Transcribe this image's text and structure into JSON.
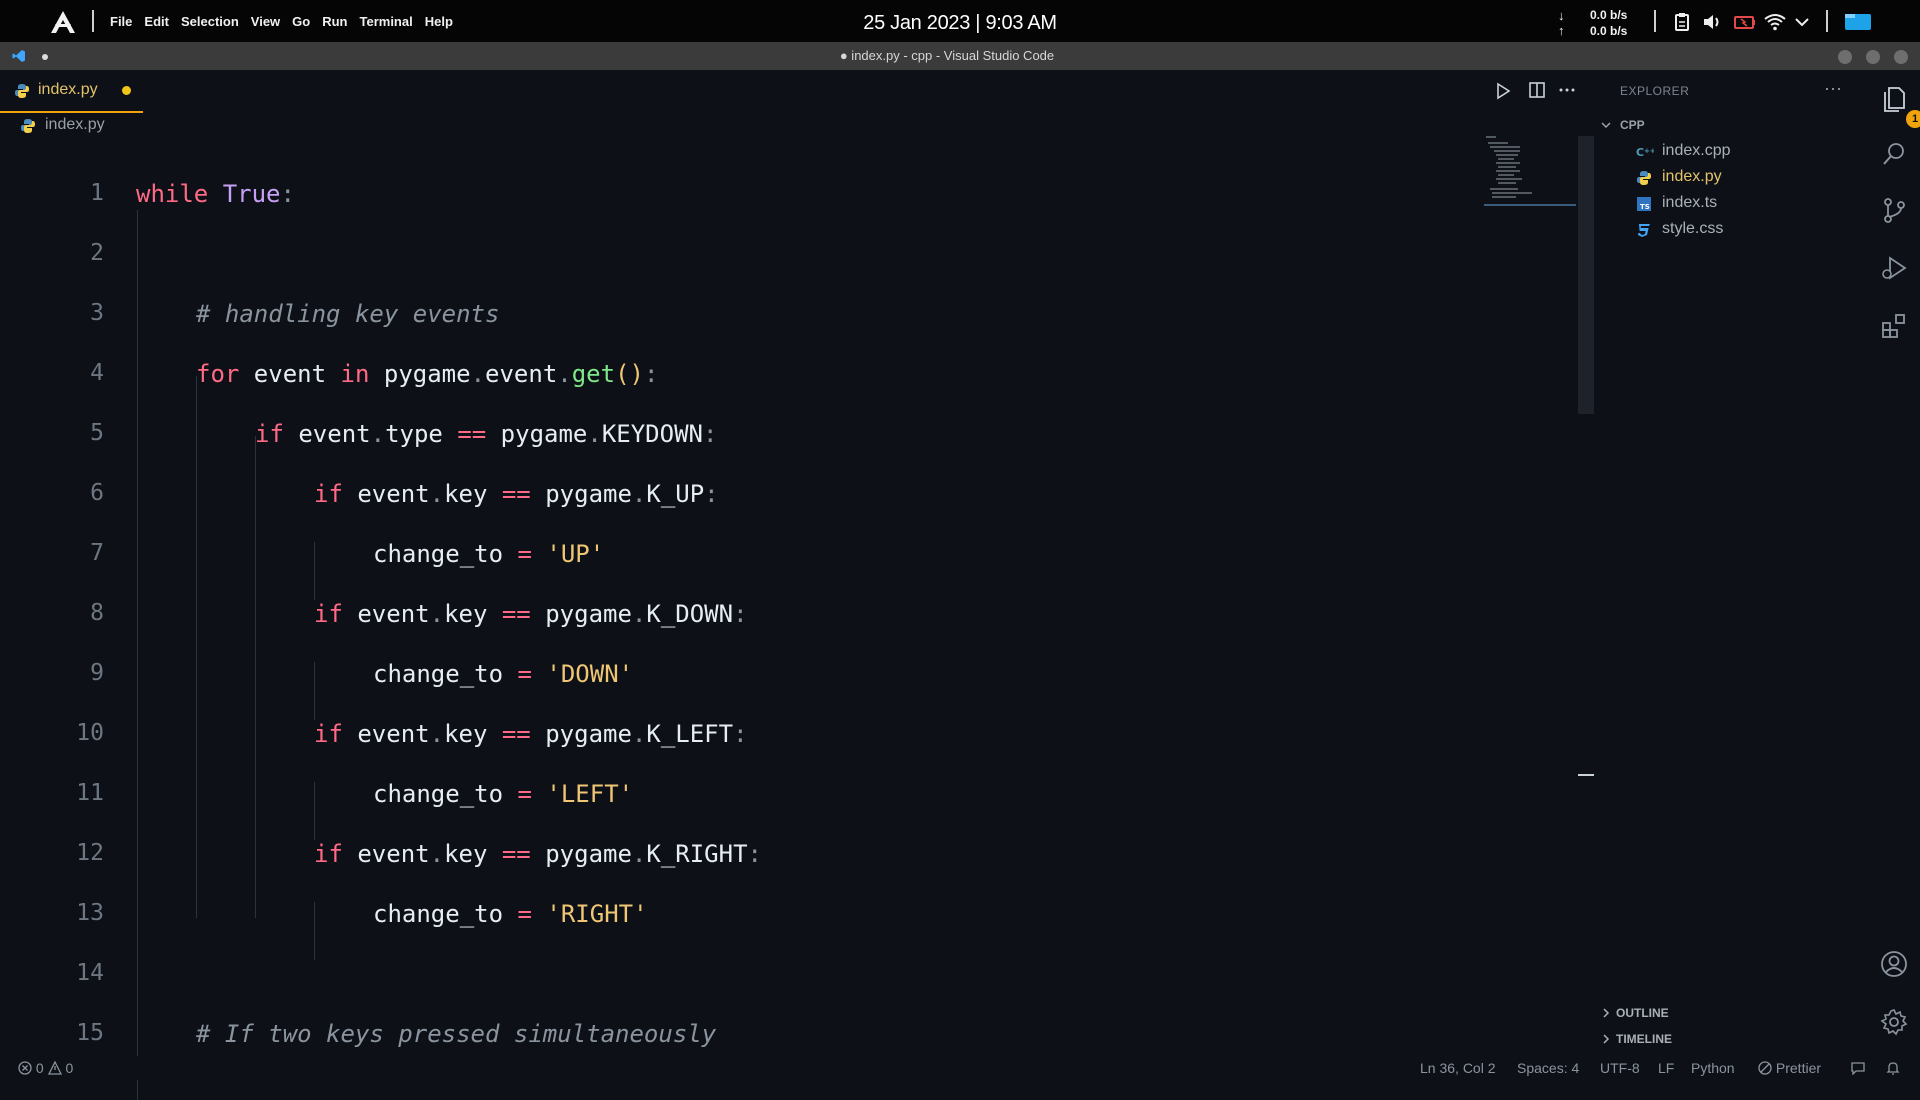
{
  "system_bar": {
    "menu": [
      "File",
      "Edit",
      "Selection",
      "View",
      "Go",
      "Run",
      "Terminal",
      "Help"
    ],
    "clock": "25 Jan 2023 | 9:03 AM",
    "net_down": "0.0 b/s",
    "net_up": "0.0 b/s",
    "down_arrow": "↓",
    "up_arrow": "↑",
    "tray_icons": [
      "clipboard-icon",
      "volume-icon",
      "battery-icon",
      "wifi-icon",
      "chevron-down-icon",
      "window-icon"
    ]
  },
  "window": {
    "title": "● index.py - cpp - Visual Studio Code"
  },
  "editor": {
    "tab_label": "index.py",
    "breadcrumb": "index.py",
    "actions": [
      "run-icon",
      "split-editor-icon",
      "more-icon"
    ],
    "line_numbers": [
      "1",
      "2",
      "3",
      "4",
      "5",
      "6",
      "7",
      "8",
      "9",
      "10",
      "11",
      "12",
      "13",
      "14",
      "15"
    ],
    "code": {
      "l1": {
        "kw": "while",
        "sp": " ",
        "val": "True",
        "colon": ":"
      },
      "l3": {
        "comment": "# handling key events"
      },
      "l4": {
        "kw1": "for",
        "a": " event ",
        "kw2": "in",
        "b": " pygame",
        "dot1": ".",
        "c": "event",
        "dot2": ".",
        "fn": "get",
        "paren": "()",
        "colon": ":"
      },
      "l5": {
        "kw": "if",
        "a": " event",
        "dot1": ".",
        "b": "type ",
        "op": "==",
        "c": " pygame",
        "dot2": ".",
        "d": "KEYDOWN",
        "colon": ":"
      },
      "l6": {
        "kw": "if",
        "a": " event",
        "dot1": ".",
        "b": "key ",
        "op": "==",
        "c": " pygame",
        "dot2": ".",
        "d": "K_UP",
        "colon": ":"
      },
      "l7": {
        "a": "change_to ",
        "op": "=",
        "str": " 'UP'"
      },
      "l8": {
        "kw": "if",
        "a": " event",
        "dot1": ".",
        "b": "key ",
        "op": "==",
        "c": " pygame",
        "dot2": ".",
        "d": "K_DOWN",
        "colon": ":"
      },
      "l9": {
        "a": "change_to ",
        "op": "=",
        "str": " 'DOWN'"
      },
      "l10": {
        "kw": "if",
        "a": " event",
        "dot1": ".",
        "b": "key ",
        "op": "==",
        "c": " pygame",
        "dot2": ".",
        "d": "K_LEFT",
        "colon": ":"
      },
      "l11": {
        "a": "change_to ",
        "op": "=",
        "str": " 'LEFT'"
      },
      "l12": {
        "kw": "if",
        "a": " event",
        "dot1": ".",
        "b": "key ",
        "op": "==",
        "c": " pygame",
        "dot2": ".",
        "d": "K_RIGHT",
        "colon": ":"
      },
      "l13": {
        "a": "change_to ",
        "op": "=",
        "str": " 'RIGHT'"
      },
      "l15": {
        "comment": "# If two keys pressed simultaneously"
      }
    }
  },
  "explorer": {
    "header": "EXPLORER",
    "folder": "CPP",
    "files": [
      {
        "name": "index.cpp",
        "icon": "cpp-file-icon"
      },
      {
        "name": "index.py",
        "icon": "python-file-icon"
      },
      {
        "name": "index.ts",
        "icon": "typescript-file-icon"
      },
      {
        "name": "style.css",
        "icon": "css-file-icon"
      }
    ],
    "outline": "OUTLINE",
    "timeline": "TIMELINE"
  },
  "activity_bar": {
    "explorer_badge": "1"
  },
  "status_bar": {
    "errors": "0",
    "warnings": "0",
    "position": "Ln 36, Col 2",
    "spaces": "Spaces: 4",
    "encoding": "UTF-8",
    "eol": "LF",
    "language": "Python",
    "formatter": "Prettier"
  },
  "colors": {
    "keyword": "#ff6a86",
    "builtin": "#c6a0f6",
    "string": "#f0c674",
    "function": "#7ee787",
    "comment": "#8b949e",
    "tab_accent": "#f0a30a",
    "modified_dot": "#f0c419"
  }
}
